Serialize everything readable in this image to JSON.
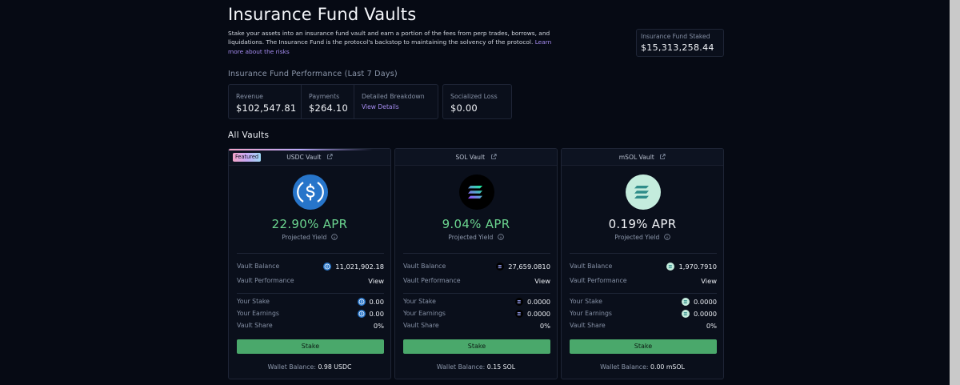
{
  "page": {
    "title": "Insurance Fund Vaults",
    "intro_text": "Stake your assets into an insurance fund vault and earn a portion of the fees from perp trades, borrows, and liquidations. The Insurance Fund is the protocol's backstop to maintaining the solvency of the protocol.",
    "intro_link": "Learn more about the risks"
  },
  "staked": {
    "label": "Insurance Fund Staked",
    "value": "$15,313,258.44"
  },
  "performance": {
    "title": "Insurance Fund Performance (Last 7 Days)",
    "revenue": {
      "label": "Revenue",
      "value": "$102,547.81"
    },
    "payments": {
      "label": "Payments",
      "value": "$264.10"
    },
    "breakdown": {
      "label": "Detailed Breakdown",
      "link": "View Details"
    },
    "socialized": {
      "label": "Socialized Loss",
      "value": "$0.00"
    }
  },
  "vaults_title": "All Vaults",
  "labels": {
    "projected": "Projected Yield",
    "vault_balance": "Vault Balance",
    "vault_performance": "Vault Performance",
    "view": "View",
    "your_stake": "Your Stake",
    "your_earnings": "Your Earnings",
    "vault_share": "Vault Share",
    "stake_button": "Stake",
    "wallet_balance": "Wallet Balance:",
    "featured": "Featured"
  },
  "vaults": [
    {
      "name": "USDC Vault",
      "apr": "22.90% APR",
      "vault_balance": "11,021,902.18",
      "your_stake": "0.00",
      "your_earnings": "0.00",
      "vault_share": "0%",
      "wallet_balance": "0.98 USDC",
      "icon": "usdc-icon",
      "apr_color": "#6bd48f"
    },
    {
      "name": "SOL Vault",
      "apr": "9.04% APR",
      "vault_balance": "27,659.0810",
      "your_stake": "0.0000",
      "your_earnings": "0.0000",
      "vault_share": "0%",
      "wallet_balance": "0.15 SOL",
      "icon": "sol-icon",
      "apr_color": "#6bd48f"
    },
    {
      "name": "mSOL Vault",
      "apr": "0.19% APR",
      "vault_balance": "1,970.7910",
      "your_stake": "0.0000",
      "your_earnings": "0.0000",
      "vault_share": "0%",
      "wallet_balance": "0.00 mSOL",
      "icon": "msol-icon",
      "apr_color": "#f2f4f8"
    }
  ],
  "colors": {
    "background": "#060a14",
    "accent_link": "#a58cf0",
    "stake_button": "#4aa86b",
    "usdc": "#2775ca",
    "msol": "#c4ecdd"
  }
}
